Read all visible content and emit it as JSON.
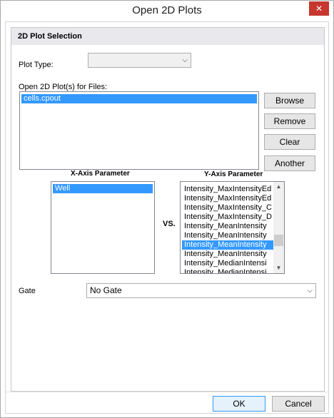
{
  "window": {
    "title": "Open 2D Plots",
    "close_glyph": "✕"
  },
  "group": {
    "header": "2D Plot Selection"
  },
  "plot_type": {
    "label": "Plot Type:",
    "value": ""
  },
  "files": {
    "label": "Open 2D Plot(s) for Files:",
    "items": [
      "cells.cpout"
    ],
    "selected_index": 0
  },
  "buttons": {
    "browse": "Browse",
    "remove": "Remove",
    "clear": "Clear",
    "another": "Another",
    "ok": "OK",
    "cancel": "Cancel"
  },
  "x_axis": {
    "label": "X-Axis Parameter",
    "items": [
      "Well"
    ],
    "selected_index": 0
  },
  "vs_label": "VS.",
  "y_axis": {
    "label": "Y-Axis Parameter",
    "items": [
      "Intensity_MaxIntensityEd",
      "Intensity_MaxIntensityEd",
      "Intensity_MaxIntensity_C",
      "Intensity_MaxIntensity_D",
      "Intensity_MeanIntensity",
      "Intensity_MeanIntensity",
      "Intensity_MeanIntensity",
      "Intensity_MeanIntensity",
      "Intensity_MedianIntensi",
      "Intensity_MedianIntensi"
    ],
    "selected_index": 6
  },
  "gate": {
    "label": "Gate",
    "value": "No Gate"
  },
  "icons": {
    "dropdown": "chevron-down-icon",
    "close": "close-icon"
  },
  "colors": {
    "selection": "#3399ff",
    "close_button": "#c7372f",
    "header_bg": "#e8e8ed"
  }
}
